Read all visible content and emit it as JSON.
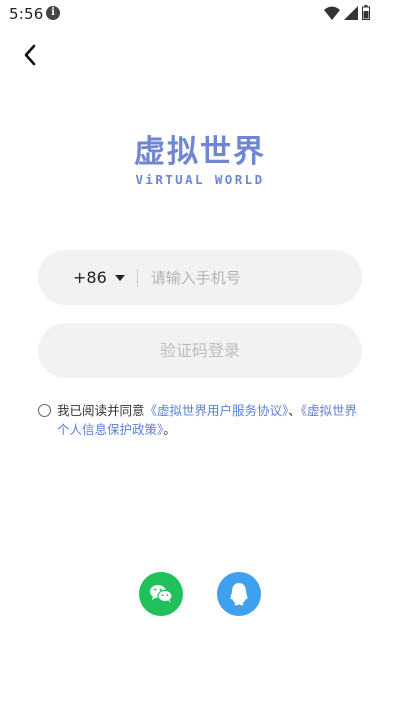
{
  "status_bar": {
    "time": "5:56",
    "info_icon": "info-icon",
    "wifi_icon": "wifi-icon",
    "signal_icon": "signal-icon",
    "battery_icon": "battery-icon"
  },
  "nav": {
    "back_icon": "chevron-left-icon"
  },
  "logo": {
    "title_cn": "虚拟世界",
    "title_en": "ViRTUAL WORLD",
    "color": "#6f86d4"
  },
  "form": {
    "country_code": "+86",
    "phone_placeholder": "请输入手机号",
    "phone_value": "",
    "login_button": "验证码登录"
  },
  "agreement": {
    "checked": false,
    "prefix": "我已阅读并同意",
    "user_agreement_link": "《虚拟世界用户服务协议》",
    "separator": "、",
    "privacy_link": "《虚拟世界个人信息保护政策》",
    "suffix": "。"
  },
  "social_login": {
    "wechat_icon": "wechat-icon",
    "wechat_color": "#20c05a",
    "qq_icon": "qq-icon",
    "qq_color": "#3fa0f0"
  }
}
